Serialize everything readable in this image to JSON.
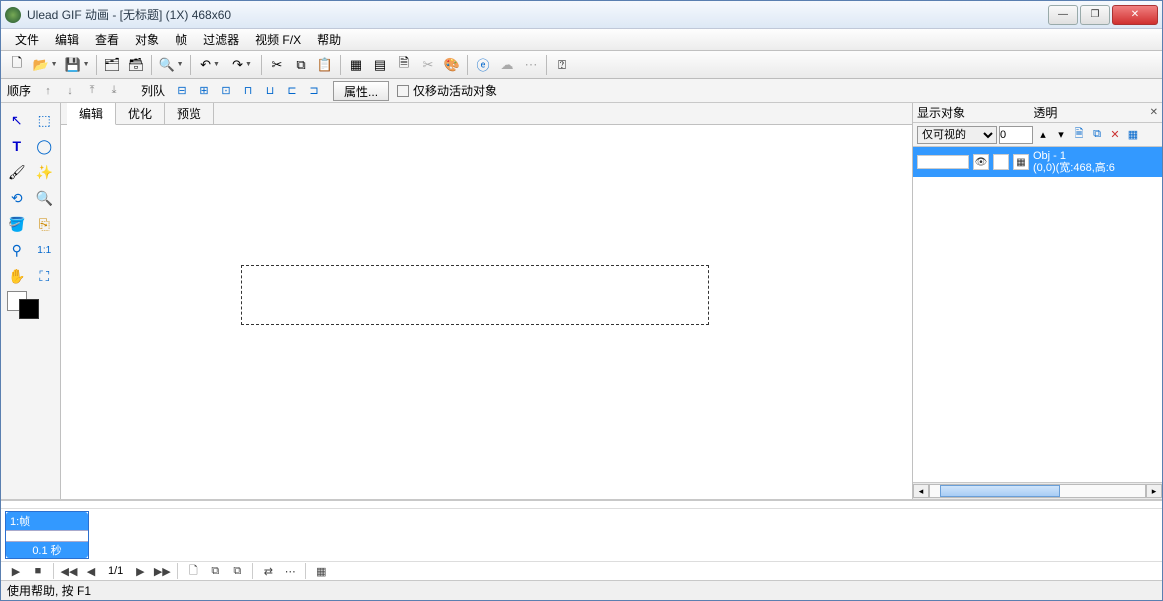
{
  "title": "Ulead GIF 动画 - [无标题] (1X) 468x60",
  "menubar": [
    "文件",
    "编辑",
    "查看",
    "对象",
    "帧",
    "过滤器",
    "视频 F/X",
    "帮助"
  ],
  "secondbar": {
    "order_label": "顺序",
    "queue_label": "列队",
    "properties_btn": "属性...",
    "move_active_label": "仅移动活动对象"
  },
  "viewtabs": [
    "编辑",
    "优化",
    "预览"
  ],
  "rightpanel": {
    "show_label": "显示对象",
    "trans_label": "透明",
    "dropdown_value": "仅可视的",
    "input_value": "0",
    "obj": {
      "name": "Obj - 1",
      "info": "(0,0)(宽:468,高:6"
    }
  },
  "timeline": {
    "frame_label": "1:帧",
    "frame_time": "0.1 秒",
    "page": "1/1"
  },
  "statusbar": "使用帮助, 按 F1",
  "icons": {
    "new": "🗋",
    "open": "📂",
    "save": "💾",
    "wizard": "🪄",
    "undo": "↶",
    "redo": "↷",
    "cut": "✂",
    "copy": "⧉",
    "paste": "📋",
    "ie": "ⓔ",
    "help": "❓",
    "arrow": "↖",
    "rect": "▭",
    "text": "T",
    "ellipse": "◯",
    "brush": "🖌",
    "wand": "✨",
    "lasso": "⟲",
    "zoom": "🔍",
    "bucket": "🪣",
    "crop": "⎘",
    "picker": "⚲",
    "scale11": "1:1",
    "hand": "✋",
    "fit": "⛶",
    "play": "▶",
    "stop": "■",
    "first": "◀◀",
    "prev": "◀",
    "next": "▶",
    "last": "▶▶"
  }
}
